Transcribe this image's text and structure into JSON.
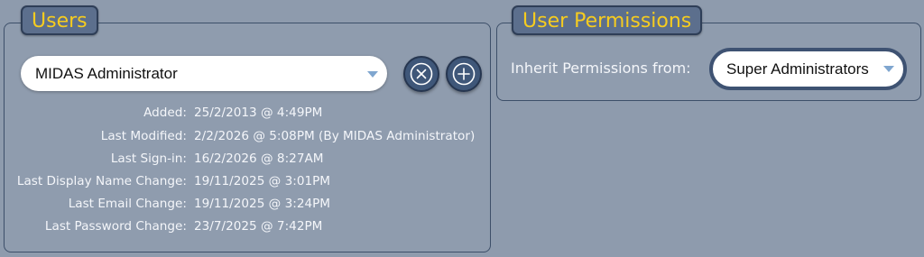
{
  "users_panel": {
    "title": "Users",
    "selected_user": "MIDAS Administrator",
    "remove_button_label": "Remove user",
    "add_button_label": "Add user",
    "details": [
      {
        "label": "Added:",
        "value": "25/2/2013 @ 4:49PM"
      },
      {
        "label": "Last Modified:",
        "value": "2/2/2026 @ 5:08PM (By MIDAS Administrator)"
      },
      {
        "label": "Last Sign-in:",
        "value": "16/2/2026 @ 8:27AM"
      },
      {
        "label": "Last Display Name Change:",
        "value": "19/11/2025 @ 3:01PM"
      },
      {
        "label": "Last Email Change:",
        "value": "19/11/2025 @ 3:24PM"
      },
      {
        "label": "Last Password Change:",
        "value": "23/7/2025 @ 7:42PM"
      }
    ]
  },
  "permissions_panel": {
    "title": "User Permissions",
    "inherit_label": "Inherit Permissions from:",
    "inherit_value": "Super Administrators"
  },
  "colors": {
    "background": "#8e9bad",
    "legend_bg": "#5c6f8d",
    "legend_text": "#f6cc1f",
    "border": "#3d4f69",
    "caret": "#7fa6cf"
  },
  "icons": {
    "remove": "circle-x-icon",
    "add": "circle-plus-icon",
    "dropdown": "caret-down-icon"
  }
}
